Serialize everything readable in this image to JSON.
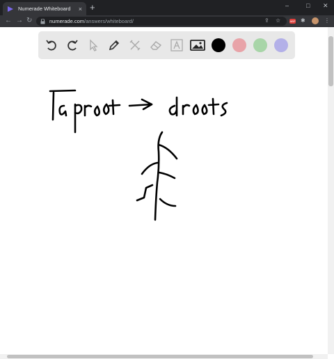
{
  "browser": {
    "tab_title": "Numerade Whiteboard",
    "tab_close": "×",
    "new_tab": "+",
    "window_controls": {
      "minimize": "–",
      "maximize": "□",
      "close": "✕"
    },
    "url_domain": "numerade.com",
    "url_path": "/answers/whiteboard/",
    "extension_badge": "ABP",
    "icons": [
      "back-icon",
      "forward-icon",
      "reload-icon",
      "lock-icon",
      "share-icon",
      "star-icon",
      "extensions-icon",
      "menu-icon"
    ]
  },
  "whiteboard": {
    "tools": [
      "undo-icon",
      "redo-icon",
      "select-icon",
      "pen-icon",
      "tools-icon",
      "eraser-icon",
      "text-icon",
      "image-icon"
    ],
    "colors": [
      "#000000",
      "#e8a3a8",
      "#a8d5a8",
      "#b3b0e8"
    ],
    "handwriting": "Taproot → droots"
  }
}
